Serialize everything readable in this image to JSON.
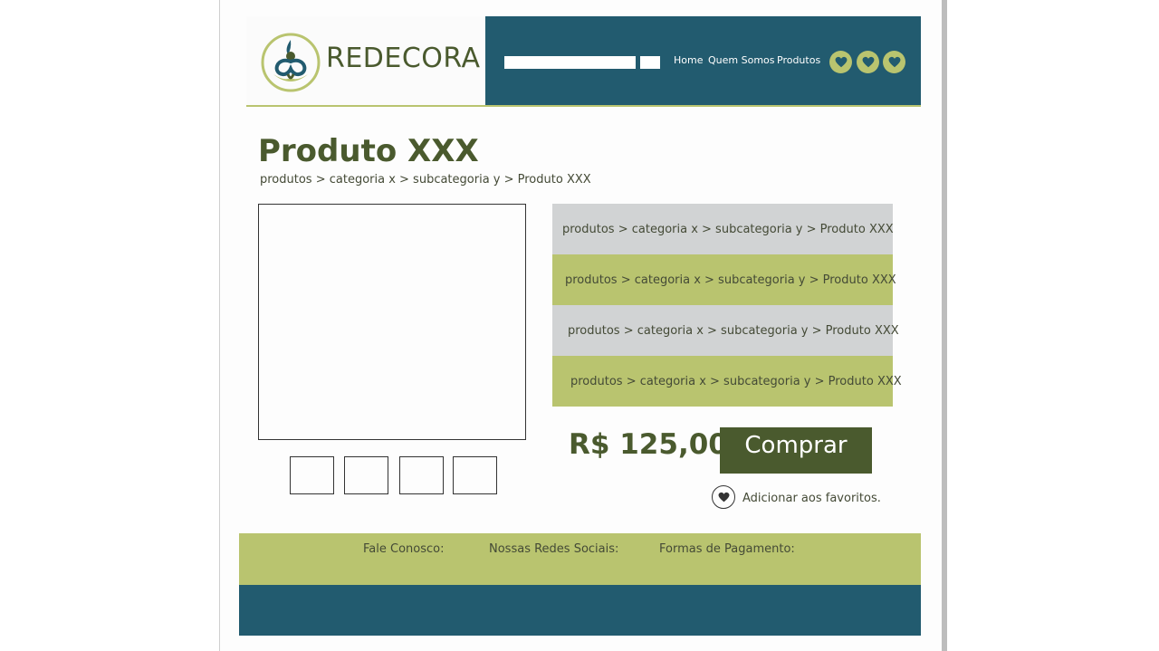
{
  "header": {
    "logo_text": "REDECORA",
    "search": {
      "value": "",
      "placeholder": ""
    },
    "nav": [
      "Home",
      "Quem Somos",
      "Produtos"
    ],
    "social_icons": [
      "heart-icon",
      "heart-icon",
      "heart-icon"
    ]
  },
  "product": {
    "title": "Produto XXX",
    "breadcrumb": "produtos > categoria x > subcategoria y > Produto XXX",
    "info_rows": [
      "produtos > categoria x > subcategoria y > Produto XXX",
      "produtos > categoria x > subcategoria y > Produto XXX",
      "produtos > categoria x > subcategoria y > Produto XXX",
      "produtos > categoria x > subcategoria y > Produto XXX"
    ],
    "price": "R$ 125,00",
    "buy_label": "Comprar",
    "favorite_label": "Adicionar aos favoritos."
  },
  "footer": {
    "contact": "Fale Conosco:",
    "social": "Nossas Redes Sociais:",
    "payment": "Formas de Pagamento:"
  },
  "colors": {
    "brand_dark_green": "#4a5a2e",
    "brand_light_green": "#b9c46f",
    "brand_teal": "#225b6f",
    "row_gray": "#d1d3d4"
  }
}
